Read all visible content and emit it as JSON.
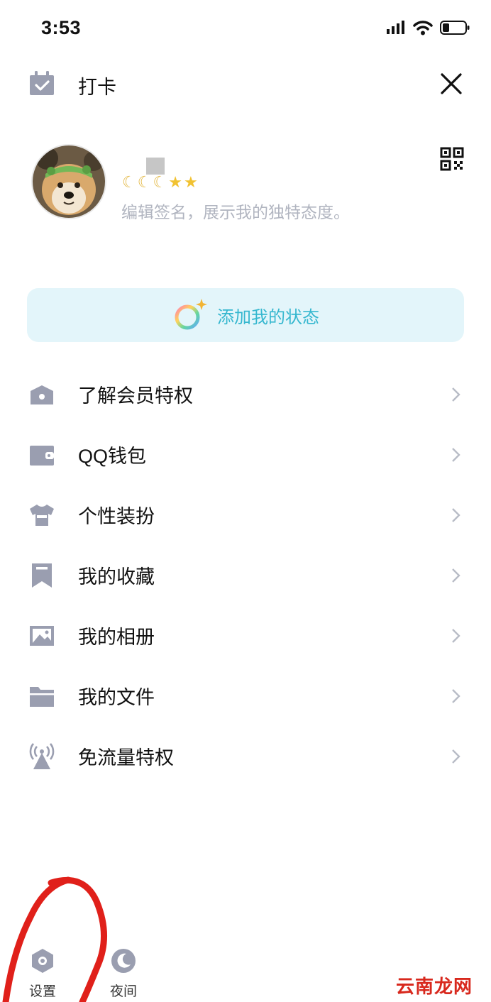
{
  "status_bar": {
    "time": "3:53"
  },
  "header": {
    "checkin_label": "打卡"
  },
  "profile": {
    "badges": {
      "moons": 3,
      "stars": 2
    },
    "signature_placeholder": "编辑签名，展示我的独特态度。"
  },
  "status_button": {
    "label": "添加我的状态"
  },
  "menu": {
    "items": [
      {
        "label": "了解会员特权",
        "icon": "crown-icon"
      },
      {
        "label": "QQ钱包",
        "icon": "wallet-icon"
      },
      {
        "label": "个性装扮",
        "icon": "tshirt-icon"
      },
      {
        "label": "我的收藏",
        "icon": "bookmark-icon"
      },
      {
        "label": "我的相册",
        "icon": "photo-icon"
      },
      {
        "label": "我的文件",
        "icon": "folder-icon"
      },
      {
        "label": "免流量特权",
        "icon": "signal-tower-icon"
      }
    ]
  },
  "bottom": {
    "settings_label": "设置",
    "night_label": "夜间"
  },
  "watermark": "云南龙网",
  "colors": {
    "icon_grey": "#9a9eb0",
    "accent_cyan": "#35b7cf",
    "status_bg": "#e3f5fa",
    "annotation_red": "#e0201a"
  }
}
